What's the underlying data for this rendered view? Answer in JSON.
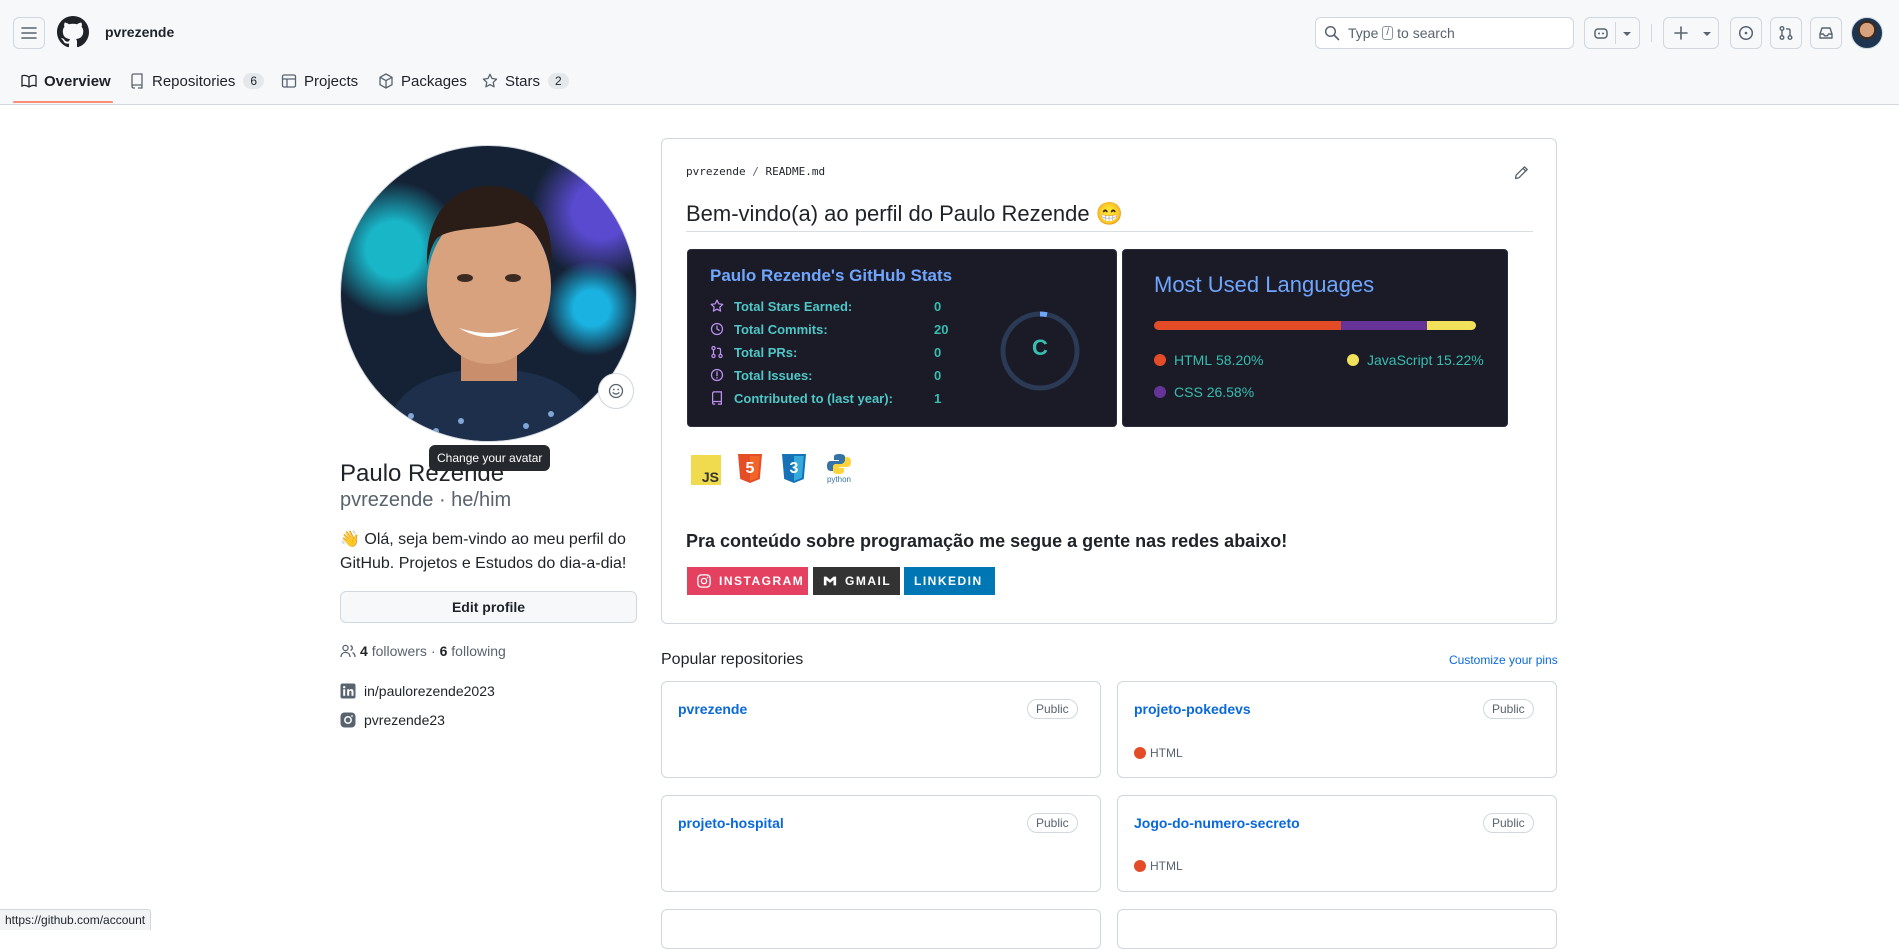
{
  "header": {
    "username": "pvrezende",
    "search_placeholder_pre": "Type",
    "search_key": "/",
    "search_placeholder_post": "to search"
  },
  "tabs": [
    {
      "label": "Overview"
    },
    {
      "label": "Repositories",
      "count": "6"
    },
    {
      "label": "Projects"
    },
    {
      "label": "Packages"
    },
    {
      "label": "Stars",
      "count": "2"
    }
  ],
  "profile": {
    "name": "Paulo Rezende",
    "login_pronouns": "pvrezende · he/him",
    "tooltip": "Change your avatar",
    "bio": "👋 Olá, seja bem-vindo ao meu perfil do GitHub. Projetos e Estudos do dia-a-dia!",
    "edit_label": "Edit profile",
    "followers_count": "4",
    "followers_label": "followers",
    "separator": "·",
    "following_count": "6",
    "following_label": "following",
    "linkedin": "in/paulorezende2023",
    "instagram": "pvrezende23"
  },
  "readme": {
    "path_user": "pvrezende",
    "path_sep": "/",
    "path_file": "README.md",
    "heading": "Bem-vindo(a) ao perfil do Paulo Rezende 😁",
    "subheading": "Pra conteúdo sobre programação me segue a gente nas redes abaixo!",
    "stats": {
      "title": "Paulo Rezende's GitHub Stats",
      "rows": [
        {
          "label": "Total Stars Earned:",
          "value": "0"
        },
        {
          "label": "Total Commits:",
          "value": "20"
        },
        {
          "label": "Total PRs:",
          "value": "0"
        },
        {
          "label": "Total Issues:",
          "value": "0"
        },
        {
          "label": "Contributed to (last year):",
          "value": "1"
        }
      ],
      "rank": "C"
    },
    "languages": {
      "title": "Most Used Languages",
      "items": [
        {
          "name": "HTML",
          "percent": "58.20%",
          "value": 58.2,
          "color": "#e34c26"
        },
        {
          "name": "CSS",
          "percent": "26.58%",
          "value": 26.58,
          "color": "#663399"
        },
        {
          "name": "JavaScript",
          "percent": "15.22%",
          "value": 15.22,
          "color": "#f1e05a"
        }
      ]
    },
    "tech_icons": [
      "JS",
      "5",
      "3",
      "python"
    ],
    "socials": [
      {
        "label": "INSTAGRAM",
        "color": "#e4405f"
      },
      {
        "label": "GMAIL",
        "color": "#333333"
      },
      {
        "label": "LINKEDIN",
        "color": "#0077b5"
      }
    ]
  },
  "popular": {
    "title": "Popular repositories",
    "customize": "Customize your pins",
    "repos": [
      {
        "name": "pvrezende",
        "visibility": "Public",
        "language": ""
      },
      {
        "name": "projeto-pokedevs",
        "visibility": "Public",
        "language": "HTML"
      },
      {
        "name": "projeto-hospital",
        "visibility": "Public",
        "language": ""
      },
      {
        "name": "Jogo-do-numero-secreto",
        "visibility": "Public",
        "language": "HTML"
      }
    ]
  },
  "statusbar": {
    "url": "https://github.com/account"
  },
  "colors": {
    "html": "#e34c26",
    "accent": "#fd8c73",
    "link": "#0969da"
  }
}
